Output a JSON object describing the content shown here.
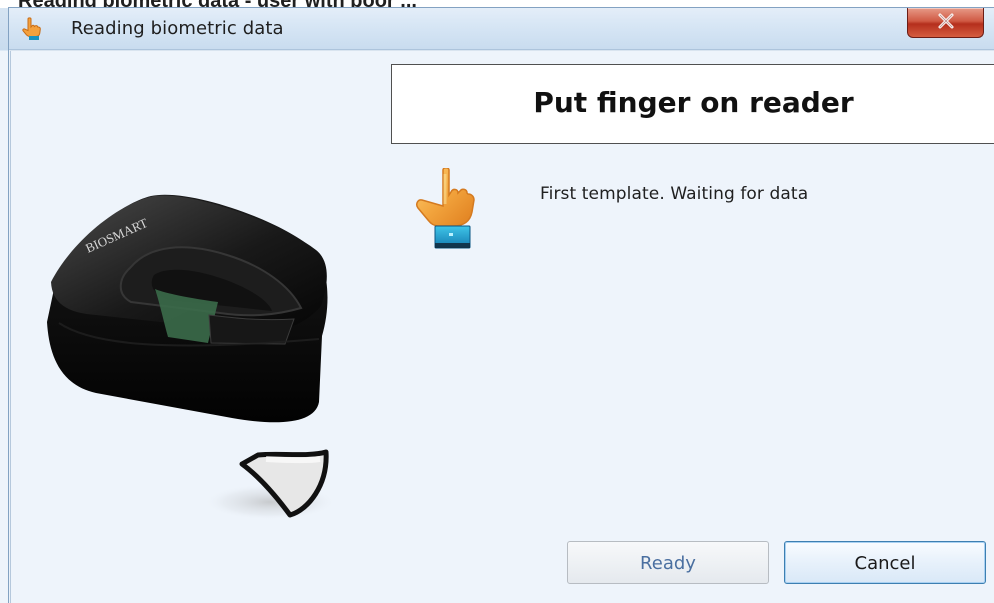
{
  "bleed_title": "Reading biometric data - user with poor ...",
  "window": {
    "title": "Reading biometric data",
    "close_icon": "close-icon"
  },
  "header": {
    "title": "Put finger on reader"
  },
  "status": {
    "message": "First template. Waiting for data",
    "icon": "pointing-hand-icon"
  },
  "illustration": {
    "name": "fingerprint-reader-image",
    "brand": "BIOSMART"
  },
  "buttons": {
    "ready_label": "Ready",
    "cancel_label": "Cancel"
  },
  "colors": {
    "title_bar": "#d7e6f5",
    "content_background": "#eef4fb",
    "close_button": "#c84530",
    "ready_text": "#4a6fa0",
    "cancel_border": "#3d7fb1"
  }
}
